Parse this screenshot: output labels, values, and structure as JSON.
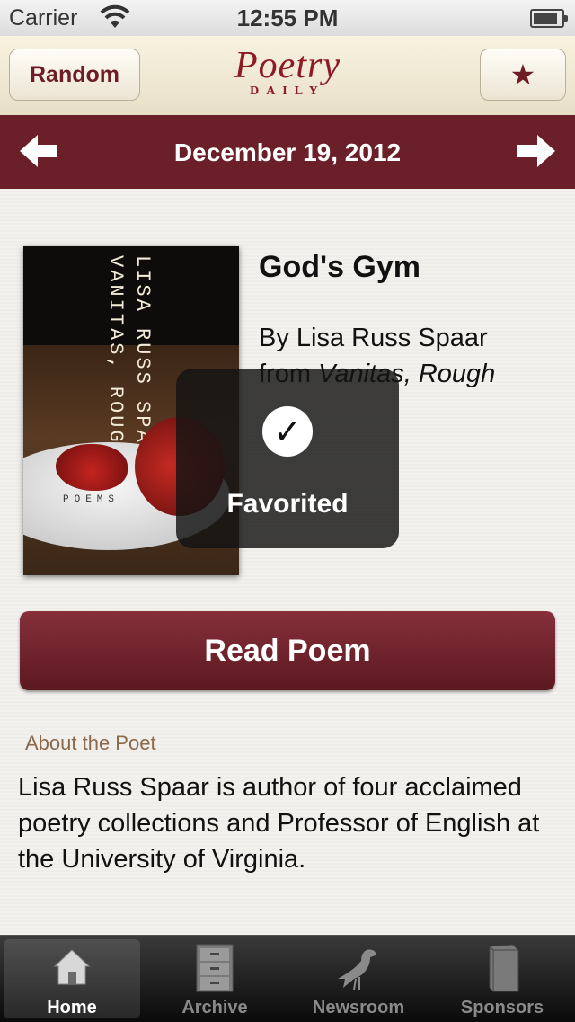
{
  "status_bar": {
    "carrier": "Carrier",
    "time": "12:55 PM"
  },
  "nav": {
    "random_label": "Random",
    "logo_word": "Poetry",
    "logo_daily": "DAILY",
    "favorite_icon": "star-icon"
  },
  "date_bar": {
    "date": "December 19, 2012",
    "prev_icon": "arrow-left-icon",
    "next_icon": "arrow-right-icon"
  },
  "book_cover": {
    "title": "VANITAS, ROUGH",
    "author": "LISA RUSS SPAAR",
    "subtitle": "POEMS"
  },
  "poem": {
    "title": "God's Gym",
    "by": "By Lisa Russ Spaar",
    "from_prefix": "from ",
    "from_book": "Vanitas, Rough"
  },
  "toast": {
    "label": "Favorited",
    "icon": "checkmark-icon"
  },
  "read_button": "Read Poem",
  "about": {
    "title": "About the Poet",
    "text": "Lisa Russ Spaar is author of four acclaimed poetry collections and Professor of English at the University of Virginia."
  },
  "tabs": [
    {
      "label": "Home",
      "icon": "home-icon",
      "selected": true
    },
    {
      "label": "Archive",
      "icon": "filing-cabinet-icon",
      "selected": false
    },
    {
      "label": "Newsroom",
      "icon": "bird-icon",
      "selected": false
    },
    {
      "label": "Sponsors",
      "icon": "book-icon",
      "selected": false
    }
  ]
}
